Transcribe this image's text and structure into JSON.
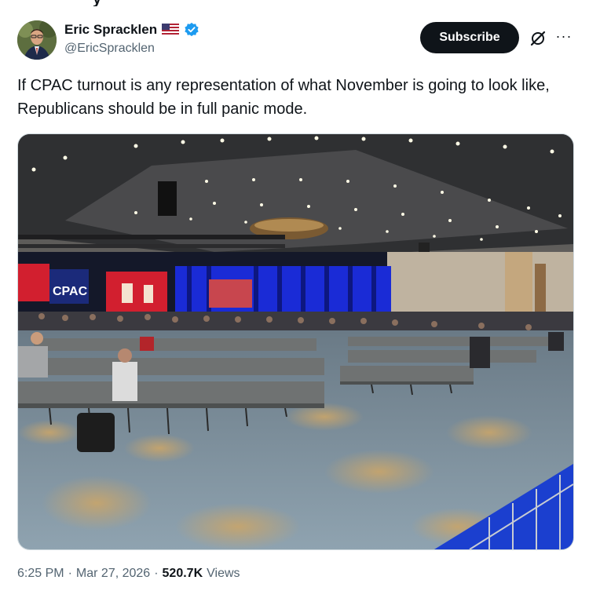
{
  "author": {
    "name": "Eric Spracklen",
    "handle": "@EricSpracklen",
    "flag_icon": "us-flag-icon",
    "verified_icon": "verified-badge-icon"
  },
  "actions": {
    "subscribe_label": "Subscribe",
    "grok_icon": "grok-icon",
    "more_icon": "more-dots-icon"
  },
  "tweet": {
    "text": "If CPAC turnout is any representation of what November is going to look like, Republicans should be in full panic mode."
  },
  "media": {
    "stage_screen_text": "CPAC"
  },
  "meta": {
    "time": "6:25 PM",
    "separator": "·",
    "date": "Mar 27, 2026",
    "views_count": "520.7K",
    "views_label": "Views"
  },
  "colors": {
    "text": "#0f1419",
    "muted": "#536471",
    "verified_blue": "#1d9bf0",
    "button_bg": "#0f1419"
  }
}
